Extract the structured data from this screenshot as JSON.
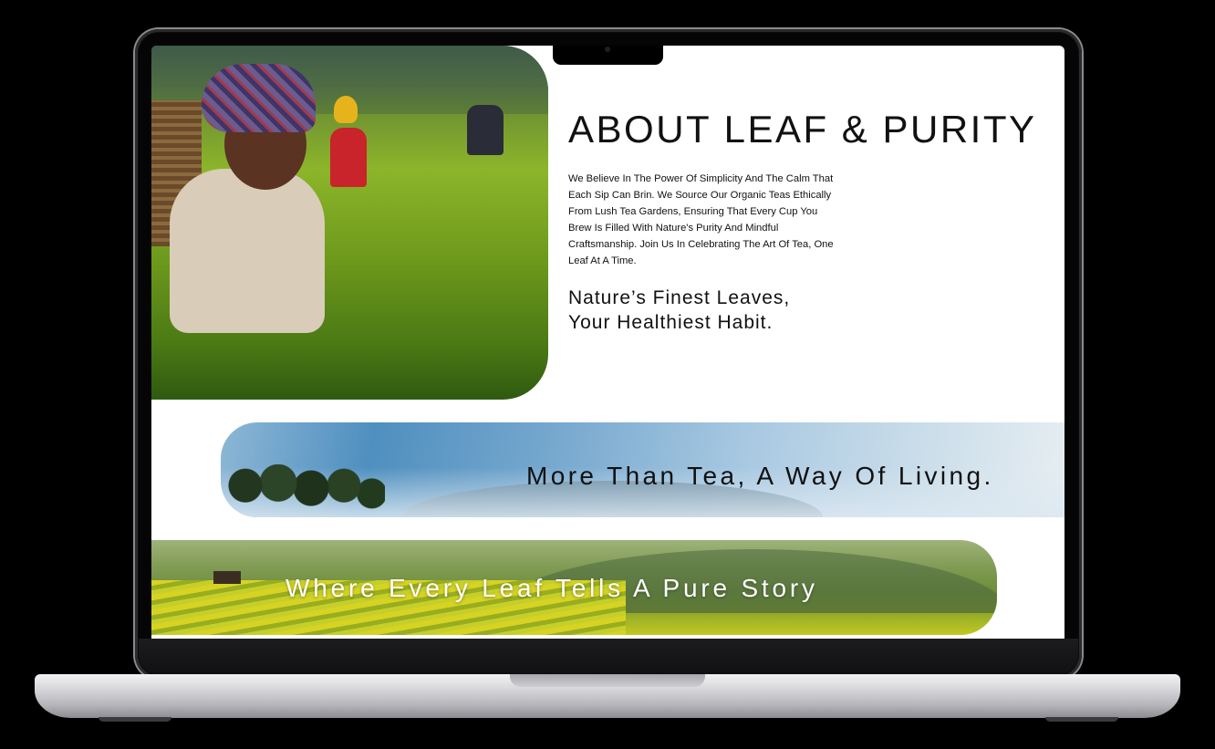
{
  "about": {
    "title": "ABOUT LEAF & PURITY",
    "body": "We Believe In The Power Of Simplicity And The Calm That Each Sip Can Brin. We Source Our Organic Teas Ethically From Lush Tea Gardens, Ensuring That Every Cup You Brew Is Filled With Nature's Purity And Mindful Craftsmanship. Join Us In Celebrating The Art Of Tea, One Leaf At A Time.",
    "tagline_line1": "Nature’s Finest Leaves,",
    "tagline_line2": "Your Healthiest Habit."
  },
  "banners": {
    "band1_text": "More Than Tea, A Way Of Living.",
    "band2_text": "Where Every Leaf Tells A Pure Story"
  },
  "colors": {
    "screen_background": "#ffffff",
    "text_dark": "#111111",
    "text_light": "#ffffff",
    "device_frame": "#0c0c0c"
  }
}
